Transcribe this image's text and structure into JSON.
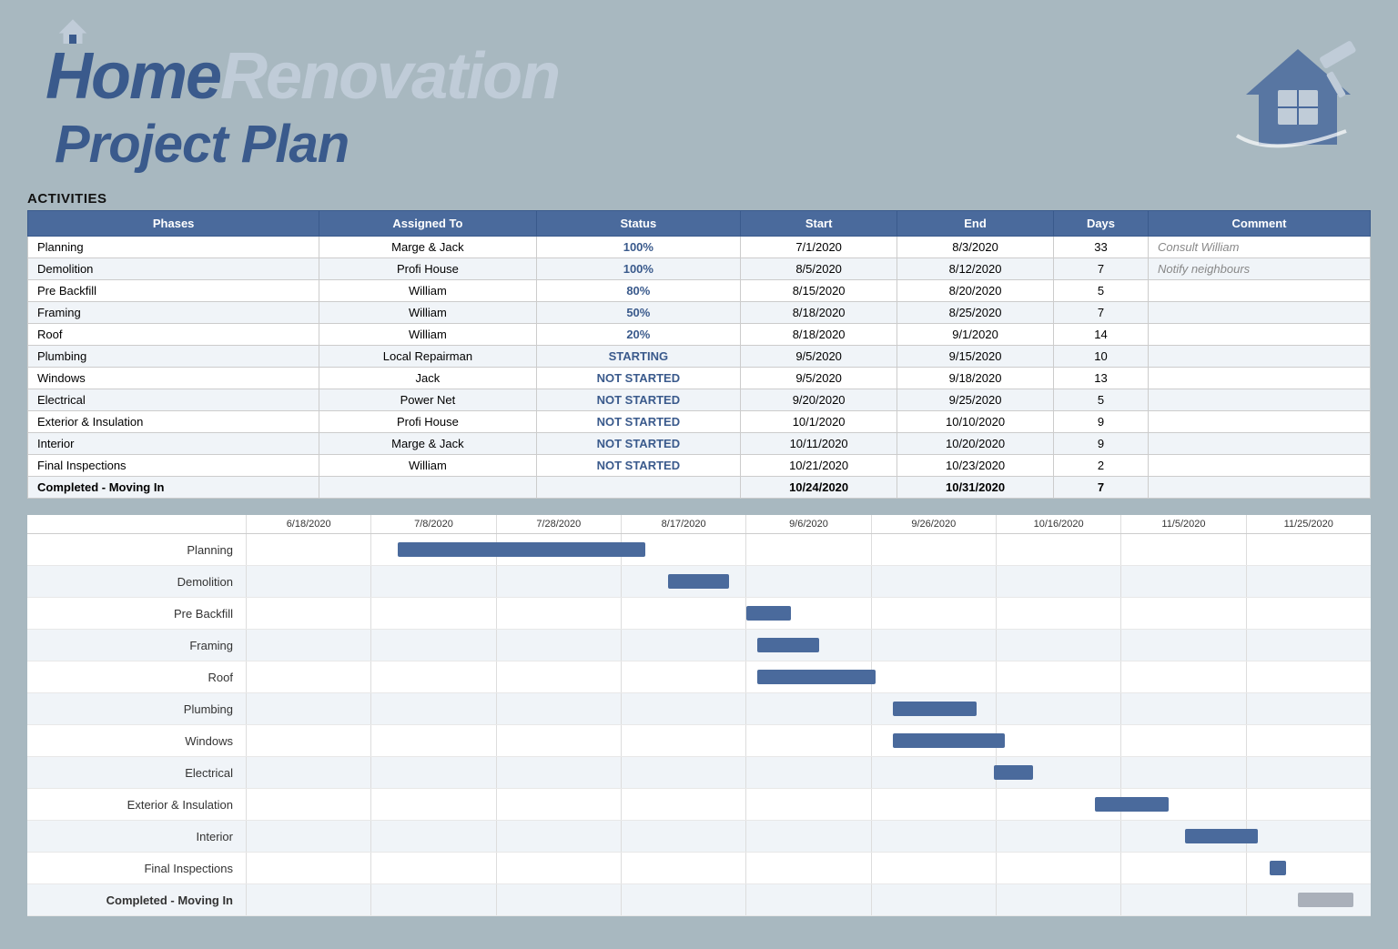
{
  "header": {
    "title_home": "Home",
    "title_renovation": "Renovation",
    "title_line2": "Project Plan"
  },
  "activities_label": "ACTIVITIES",
  "table": {
    "columns": [
      "Phases",
      "Assigned To",
      "Status",
      "Start",
      "End",
      "Days",
      "Comment"
    ],
    "rows": [
      {
        "phase": "Planning",
        "assigned": "Marge & Jack",
        "status": "100%",
        "status_type": "pct",
        "start": "7/1/2020",
        "end": "8/3/2020",
        "days": "33",
        "comment": "Consult William"
      },
      {
        "phase": "Demolition",
        "assigned": "Profi House",
        "status": "100%",
        "status_type": "pct",
        "start": "8/5/2020",
        "end": "8/12/2020",
        "days": "7",
        "comment": "Notify neighbours"
      },
      {
        "phase": "Pre Backfill",
        "assigned": "William",
        "status": "80%",
        "status_type": "pct",
        "start": "8/15/2020",
        "end": "8/20/2020",
        "days": "5",
        "comment": ""
      },
      {
        "phase": "Framing",
        "assigned": "William",
        "status": "50%",
        "status_type": "pct",
        "start": "8/18/2020",
        "end": "8/25/2020",
        "days": "7",
        "comment": ""
      },
      {
        "phase": "Roof",
        "assigned": "William",
        "status": "20%",
        "status_type": "pct",
        "start": "8/18/2020",
        "end": "9/1/2020",
        "days": "14",
        "comment": ""
      },
      {
        "phase": "Plumbing",
        "assigned": "Local Repairman",
        "status": "STARTING",
        "status_type": "starting",
        "start": "9/5/2020",
        "end": "9/15/2020",
        "days": "10",
        "comment": ""
      },
      {
        "phase": "Windows",
        "assigned": "Jack",
        "status": "NOT STARTED",
        "status_type": "notstarted",
        "start": "9/5/2020",
        "end": "9/18/2020",
        "days": "13",
        "comment": ""
      },
      {
        "phase": "Electrical",
        "assigned": "Power Net",
        "status": "NOT STARTED",
        "status_type": "notstarted",
        "start": "9/20/2020",
        "end": "9/25/2020",
        "days": "5",
        "comment": ""
      },
      {
        "phase": "Exterior & Insulation",
        "assigned": "Profi House",
        "status": "NOT STARTED",
        "status_type": "notstarted",
        "start": "10/1/2020",
        "end": "10/10/2020",
        "days": "9",
        "comment": ""
      },
      {
        "phase": "Interior",
        "assigned": "Marge & Jack",
        "status": "NOT STARTED",
        "status_type": "notstarted",
        "start": "10/11/2020",
        "end": "10/20/2020",
        "days": "9",
        "comment": ""
      },
      {
        "phase": "Final Inspections",
        "assigned": "William",
        "status": "NOT STARTED",
        "status_type": "notstarted",
        "start": "10/21/2020",
        "end": "10/23/2020",
        "days": "2",
        "comment": ""
      },
      {
        "phase": "Completed - Moving In",
        "assigned": "",
        "status": "",
        "status_type": "bold",
        "start": "10/24/2020",
        "end": "10/31/2020",
        "days": "7",
        "comment": ""
      }
    ]
  },
  "gantt": {
    "date_labels": [
      "6/18/2020",
      "7/8/2020",
      "7/28/2020",
      "8/17/2020",
      "9/6/2020",
      "9/26/2020",
      "10/16/2020",
      "11/5/2020",
      "11/25/2020"
    ],
    "rows": [
      {
        "label": "Planning",
        "bold": false,
        "bar_type": "blue",
        "start_pct": 13.5,
        "width_pct": 22
      },
      {
        "label": "Demolition",
        "bold": false,
        "bar_type": "blue",
        "start_pct": 37.5,
        "width_pct": 5.5
      },
      {
        "label": "Pre Backfill",
        "bold": false,
        "bar_type": "blue",
        "start_pct": 44.5,
        "width_pct": 4
      },
      {
        "label": "Framing",
        "bold": false,
        "bar_type": "blue",
        "start_pct": 45.5,
        "width_pct": 5.5
      },
      {
        "label": "Roof",
        "bold": false,
        "bar_type": "blue",
        "start_pct": 45.5,
        "width_pct": 10.5
      },
      {
        "label": "Plumbing",
        "bold": false,
        "bar_type": "blue",
        "start_pct": 57.5,
        "width_pct": 7.5
      },
      {
        "label": "Windows",
        "bold": false,
        "bar_type": "blue",
        "start_pct": 57.5,
        "width_pct": 10
      },
      {
        "label": "Electrical",
        "bold": false,
        "bar_type": "blue",
        "start_pct": 66.5,
        "width_pct": 3.5
      },
      {
        "label": "Exterior & Insulation",
        "bold": false,
        "bar_type": "blue",
        "start_pct": 75.5,
        "width_pct": 6.5
      },
      {
        "label": "Interior",
        "bold": false,
        "bar_type": "blue",
        "start_pct": 83.5,
        "width_pct": 6.5
      },
      {
        "label": "Final Inspections",
        "bold": false,
        "bar_type": "blue",
        "start_pct": 91,
        "width_pct": 1.5
      },
      {
        "label": "Completed - Moving In",
        "bold": true,
        "bar_type": "gray",
        "start_pct": 93.5,
        "width_pct": 5
      }
    ]
  }
}
